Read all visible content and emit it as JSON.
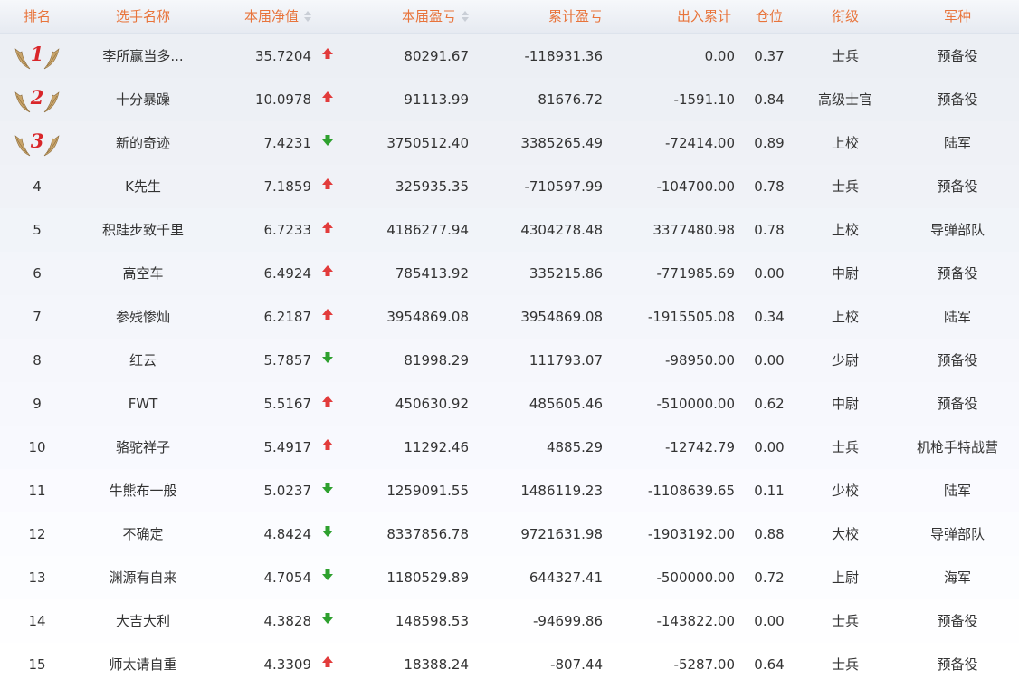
{
  "columns": {
    "rank": "排名",
    "name": "选手名称",
    "nav": "本届净值",
    "pl": "本届盈亏",
    "cum": "累计盈亏",
    "flow": "出入累计",
    "pos": "仓位",
    "title": "衔级",
    "arm": "军种"
  },
  "colors": {
    "header_text": "#e8743b",
    "trend_up": "#e23b3b",
    "trend_down": "#2ea02e",
    "medal_number": "#d9262a",
    "wing": "#c8a46a"
  },
  "rows": [
    {
      "rank": "1",
      "medal": true,
      "name": "李所赢当多...",
      "nav": "35.7204",
      "trend": "up",
      "pl": "80291.67",
      "cum": "-118931.36",
      "flow": "0.00",
      "pos": "0.37",
      "title": "士兵",
      "arm": "预备役"
    },
    {
      "rank": "2",
      "medal": true,
      "name": "十分暴躁",
      "nav": "10.0978",
      "trend": "up",
      "pl": "91113.99",
      "cum": "81676.72",
      "flow": "-1591.10",
      "pos": "0.84",
      "title": "高级士官",
      "arm": "预备役"
    },
    {
      "rank": "3",
      "medal": true,
      "name": "新的奇迹",
      "nav": "7.4231",
      "trend": "down",
      "pl": "3750512.40",
      "cum": "3385265.49",
      "flow": "-72414.00",
      "pos": "0.89",
      "title": "上校",
      "arm": "陆军"
    },
    {
      "rank": "4",
      "medal": false,
      "name": "K先生",
      "nav": "7.1859",
      "trend": "up",
      "pl": "325935.35",
      "cum": "-710597.99",
      "flow": "-104700.00",
      "pos": "0.78",
      "title": "士兵",
      "arm": "预备役"
    },
    {
      "rank": "5",
      "medal": false,
      "name": "积跬步致千里",
      "nav": "6.7233",
      "trend": "up",
      "pl": "4186277.94",
      "cum": "4304278.48",
      "flow": "3377480.98",
      "pos": "0.78",
      "title": "上校",
      "arm": "导弹部队"
    },
    {
      "rank": "6",
      "medal": false,
      "name": "高空车",
      "nav": "6.4924",
      "trend": "up",
      "pl": "785413.92",
      "cum": "335215.86",
      "flow": "-771985.69",
      "pos": "0.00",
      "title": "中尉",
      "arm": "预备役"
    },
    {
      "rank": "7",
      "medal": false,
      "name": "参残惨灿",
      "nav": "6.2187",
      "trend": "up",
      "pl": "3954869.08",
      "cum": "3954869.08",
      "flow": "-1915505.08",
      "pos": "0.34",
      "title": "上校",
      "arm": "陆军"
    },
    {
      "rank": "8",
      "medal": false,
      "name": "红云",
      "nav": "5.7857",
      "trend": "down",
      "pl": "81998.29",
      "cum": "111793.07",
      "flow": "-98950.00",
      "pos": "0.00",
      "title": "少尉",
      "arm": "预备役"
    },
    {
      "rank": "9",
      "medal": false,
      "name": "FWT",
      "nav": "5.5167",
      "trend": "up",
      "pl": "450630.92",
      "cum": "485605.46",
      "flow": "-510000.00",
      "pos": "0.62",
      "title": "中尉",
      "arm": "预备役"
    },
    {
      "rank": "10",
      "medal": false,
      "name": "骆驼祥子",
      "nav": "5.4917",
      "trend": "up",
      "pl": "11292.46",
      "cum": "4885.29",
      "flow": "-12742.79",
      "pos": "0.00",
      "title": "士兵",
      "arm": "机枪手特战营"
    },
    {
      "rank": "11",
      "medal": false,
      "name": "牛熊布一般",
      "nav": "5.0237",
      "trend": "down",
      "pl": "1259091.55",
      "cum": "1486119.23",
      "flow": "-1108639.65",
      "pos": "0.11",
      "title": "少校",
      "arm": "陆军"
    },
    {
      "rank": "12",
      "medal": false,
      "name": "不确定",
      "nav": "4.8424",
      "trend": "down",
      "pl": "8337856.78",
      "cum": "9721631.98",
      "flow": "-1903192.00",
      "pos": "0.88",
      "title": "大校",
      "arm": "导弹部队"
    },
    {
      "rank": "13",
      "medal": false,
      "name": "渊源有自来",
      "nav": "4.7054",
      "trend": "down",
      "pl": "1180529.89",
      "cum": "644327.41",
      "flow": "-500000.00",
      "pos": "0.72",
      "title": "上尉",
      "arm": "海军"
    },
    {
      "rank": "14",
      "medal": false,
      "name": "大吉大利",
      "nav": "4.3828",
      "trend": "down",
      "pl": "148598.53",
      "cum": "-94699.86",
      "flow": "-143822.00",
      "pos": "0.00",
      "title": "士兵",
      "arm": "预备役"
    },
    {
      "rank": "15",
      "medal": false,
      "name": "师太请自重",
      "nav": "4.3309",
      "trend": "up",
      "pl": "18388.24",
      "cum": "-807.44",
      "flow": "-5287.00",
      "pos": "0.64",
      "title": "士兵",
      "arm": "预备役"
    }
  ]
}
